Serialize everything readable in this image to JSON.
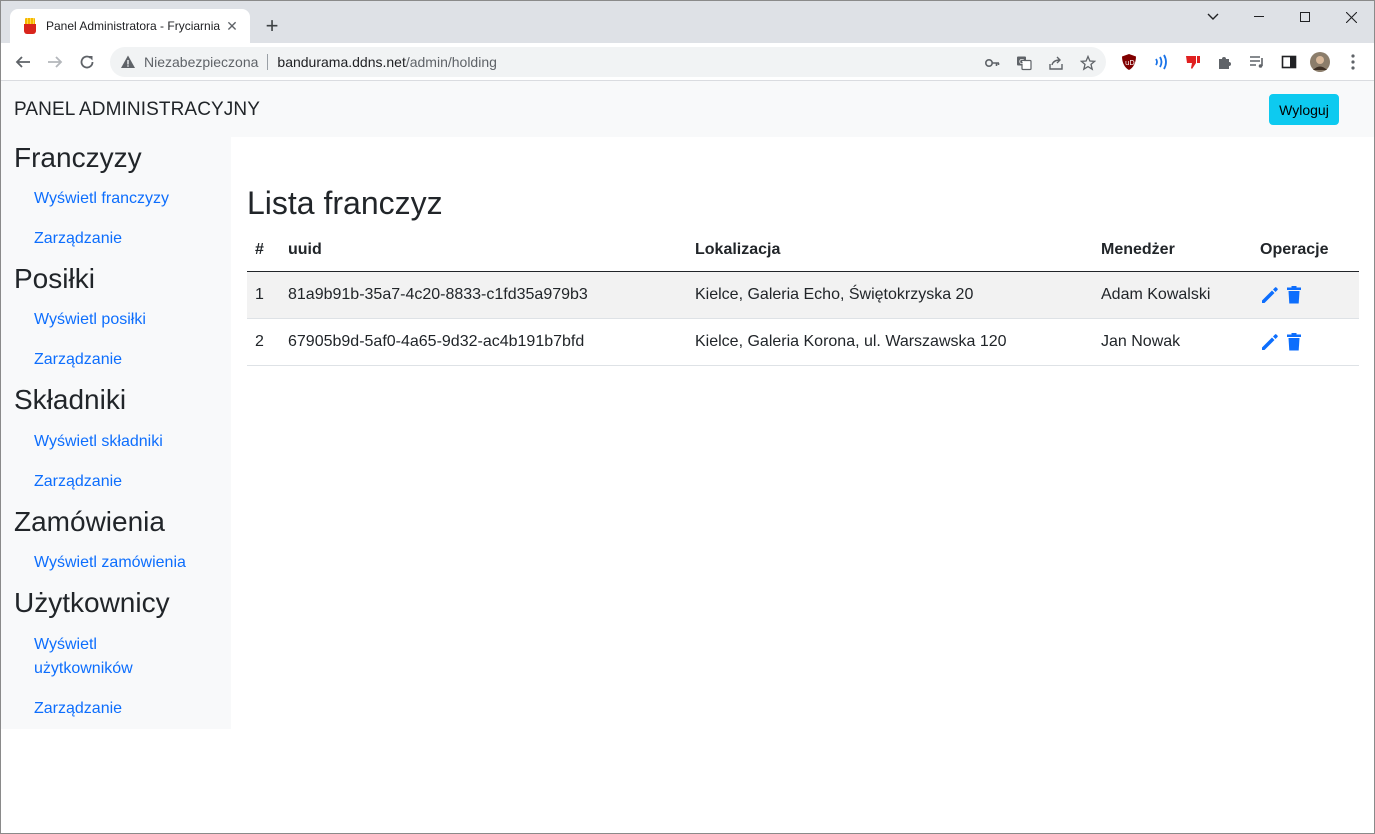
{
  "browser": {
    "tab_title": "Panel Administratora - Fryciarnia",
    "omnibox": {
      "security_label": "Niezabezpieczona",
      "host": "bandurama.ddns.net",
      "path": "/admin/holding"
    }
  },
  "navbar": {
    "brand": "PANEL ADMINISTRACYJNY",
    "logout_label": "Wyloguj"
  },
  "sidebar": {
    "sections": [
      {
        "heading": "Franczyzy",
        "links": [
          "Wyświetl franczyzy",
          "Zarządzanie"
        ]
      },
      {
        "heading": "Posiłki",
        "links": [
          "Wyświetl posiłki",
          "Zarządzanie"
        ]
      },
      {
        "heading": "Składniki",
        "links": [
          "Wyświetl składniki",
          "Zarządzanie"
        ]
      },
      {
        "heading": "Zamówienia",
        "links": [
          "Wyświetl zamówienia"
        ]
      },
      {
        "heading": "Użytkownicy",
        "links": [
          "Wyświetl użytkowników",
          "Zarządzanie"
        ]
      }
    ]
  },
  "main": {
    "title": "Lista franczyz",
    "table": {
      "headers": [
        "#",
        "uuid",
        "Lokalizacja",
        "Menedżer",
        "Operacje"
      ],
      "rows": [
        [
          "1",
          "81a9b91b-35a7-4c20-8833-c1fd35a979b3",
          "Kielce, Galeria Echo, Świętokrzyska 20",
          "Adam Kowalski"
        ],
        [
          "2",
          "67905b9d-5af0-4a65-9d32-ac4b191b7bfd",
          "Kielce, Galeria Korona, ul. Warszawska 120",
          "Jan Nowak"
        ]
      ]
    }
  },
  "colors": {
    "link": "#0d6efd",
    "logout_button": "#0dcaf0",
    "icon_blue": "#0d6efd",
    "sidebar_bg": "#f8f9fa"
  },
  "icons": {
    "edit": "pencil-icon",
    "delete": "trash-icon"
  }
}
